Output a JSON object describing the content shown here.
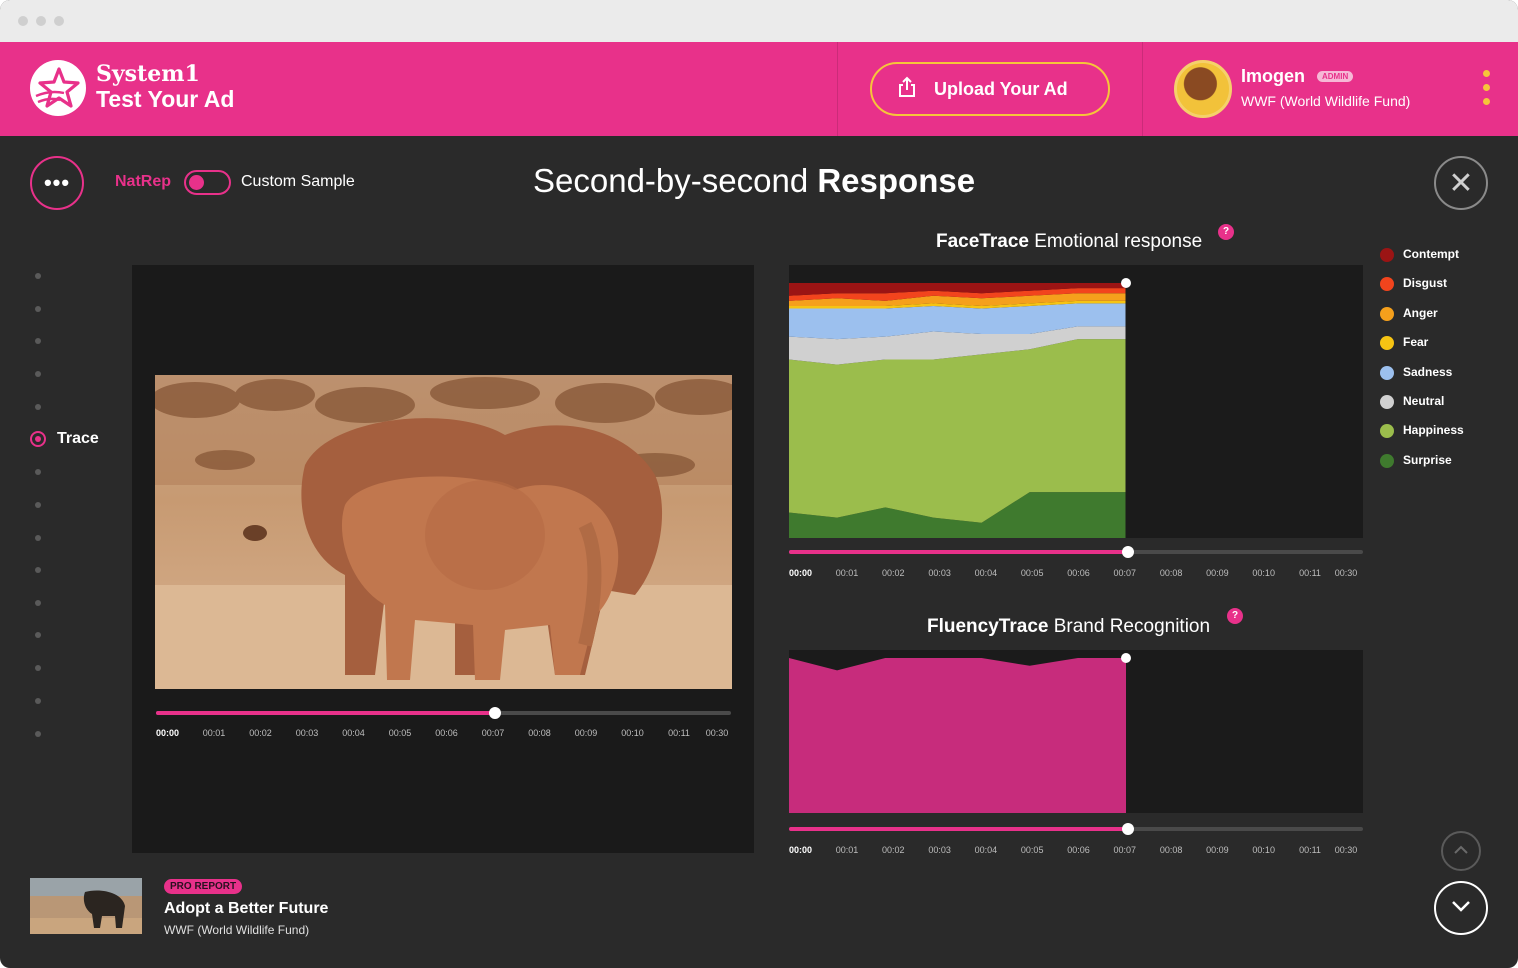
{
  "brand": {
    "line1": "System1",
    "line2": "Test Your Ad"
  },
  "header": {
    "upload_label": "Upload Your Ad"
  },
  "user": {
    "name": "Imogen",
    "role_badge": "ADMIN",
    "org": "WWF (World Wildlife Fund)"
  },
  "controls": {
    "sample_left": "NatRep",
    "sample_right": "Custom Sample"
  },
  "page_title": {
    "prefix": "Second-by-second ",
    "bold": "Response"
  },
  "nav_rail": {
    "active_label": "Trace"
  },
  "video_timeline": {
    "ticks": [
      "00:00",
      "00:01",
      "00:02",
      "00:03",
      "00:04",
      "00:05",
      "00:06",
      "00:07",
      "00:08",
      "00:09",
      "00:10",
      "00:11",
      "00:30"
    ],
    "progress": 0.59
  },
  "facetrace": {
    "title_bold": "FaceTrace",
    "title_rest": " Emotional response",
    "help": "?"
  },
  "fluencytrace": {
    "title_bold": "FluencyTrace",
    "title_rest": " Brand Recognition",
    "help": "?"
  },
  "chart_ticks": [
    "00:00",
    "00:01",
    "00:02",
    "00:03",
    "00:04",
    "00:05",
    "00:06",
    "00:07",
    "00:08",
    "00:09",
    "00:10",
    "00:11",
    "00:30"
  ],
  "chart_progress": 0.59,
  "legend": [
    {
      "label": "Contempt",
      "color": "#9b1414"
    },
    {
      "label": "Disgust",
      "color": "#f2441d"
    },
    {
      "label": "Anger",
      "color": "#f5a01c"
    },
    {
      "label": "Fear",
      "color": "#f6c413"
    },
    {
      "label": "Sadness",
      "color": "#9cc0ee"
    },
    {
      "label": "Neutral",
      "color": "#d0d0d0"
    },
    {
      "label": "Happiness",
      "color": "#9bbd4c"
    },
    {
      "label": "Surprise",
      "color": "#3f7a2e"
    }
  ],
  "ad": {
    "badge": "PRO REPORT",
    "title": "Adopt a Better Future",
    "org": "WWF (World Wildlife Fund)"
  },
  "chart_data": [
    {
      "type": "area",
      "x": [
        "00:00",
        "00:01",
        "00:02",
        "00:03",
        "00:04",
        "00:05",
        "00:06",
        "00:07"
      ],
      "ylim": [
        0,
        100
      ],
      "stacked": true,
      "series": [
        {
          "name": "Surprise",
          "values": [
            10,
            8,
            12,
            8,
            6,
            18,
            18,
            18
          ]
        },
        {
          "name": "Happiness",
          "values": [
            60,
            60,
            58,
            62,
            66,
            56,
            60,
            60
          ]
        },
        {
          "name": "Neutral",
          "values": [
            9,
            10,
            9,
            11,
            8,
            6,
            5,
            5
          ]
        },
        {
          "name": "Sadness",
          "values": [
            11,
            12,
            11,
            10,
            10,
            11,
            9,
            9
          ]
        },
        {
          "name": "Fear",
          "values": [
            1,
            1,
            1,
            1,
            1,
            1,
            1,
            1
          ]
        },
        {
          "name": "Anger",
          "values": [
            2,
            3,
            2,
            3,
            3,
            3,
            3,
            3
          ]
        },
        {
          "name": "Disgust",
          "values": [
            2,
            2,
            3,
            2,
            2,
            2,
            2,
            2
          ]
        },
        {
          "name": "Contempt",
          "values": [
            5,
            4,
            4,
            3,
            4,
            3,
            2,
            2
          ]
        }
      ]
    },
    {
      "type": "area",
      "x": [
        "00:00",
        "00:01",
        "00:02",
        "00:03",
        "00:04",
        "00:05",
        "00:06",
        "00:07"
      ],
      "ylim": [
        0,
        100
      ],
      "series": [
        {
          "name": "Brand Recognition",
          "values": [
            100,
            92,
            100,
            100,
            100,
            95,
            100,
            100
          ]
        }
      ]
    }
  ]
}
